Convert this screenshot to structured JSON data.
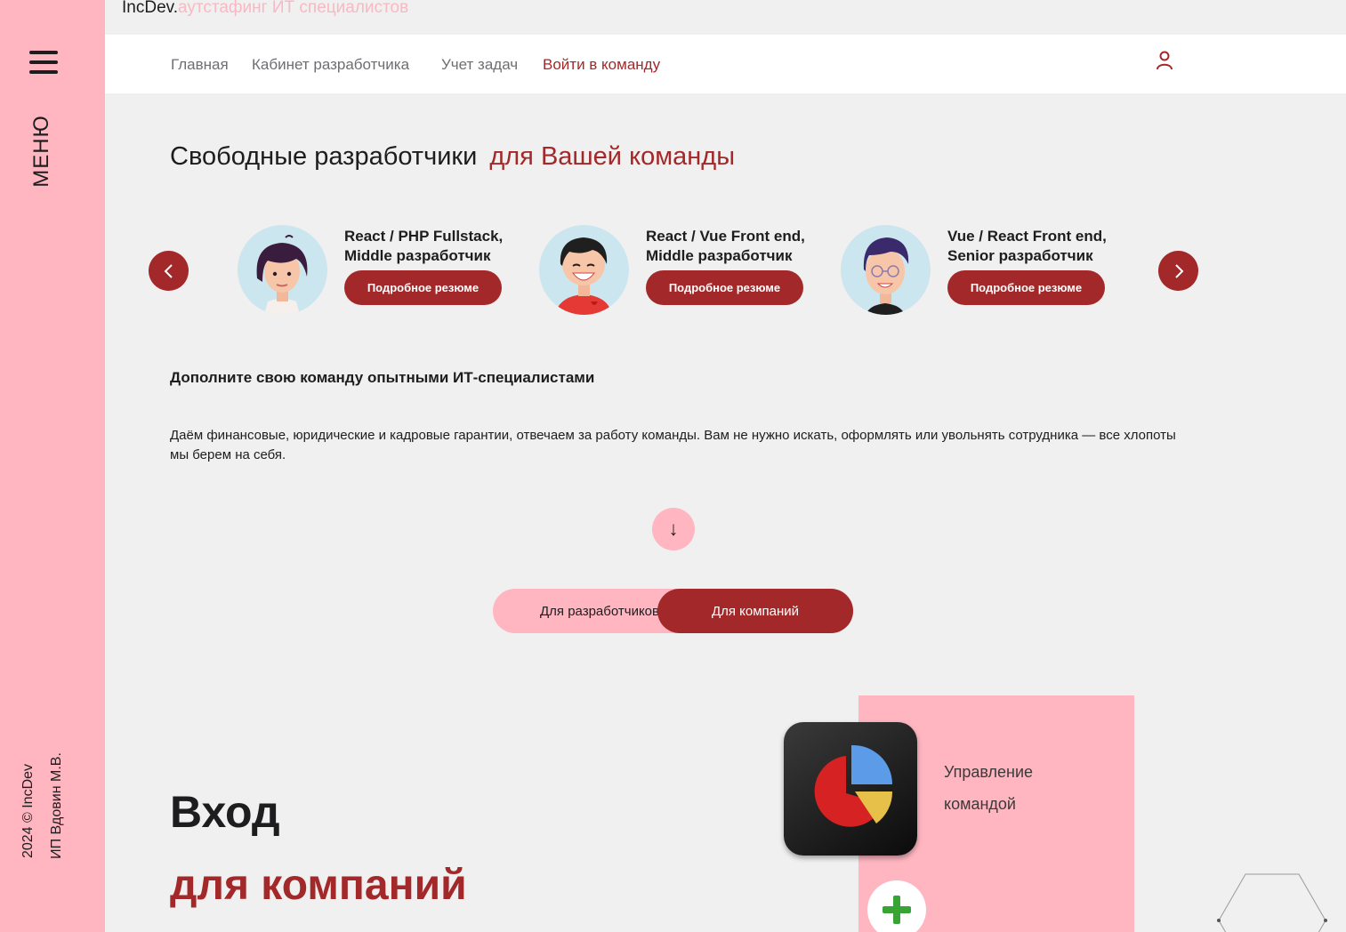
{
  "brand": {
    "name": "IncDev.",
    "tagline": "аутстафинг ИТ специалистов"
  },
  "sidebar": {
    "menu_label": "МЕНЮ",
    "copyright": "2024 © IncDev",
    "owner": "ИП Вдовин М.В."
  },
  "nav": {
    "items": [
      {
        "label": "Главная"
      },
      {
        "label": "Кабинет разработчика"
      },
      {
        "label": "Учет задач"
      },
      {
        "label": "Войти в команду"
      }
    ]
  },
  "hero": {
    "headline": "Свободные разработчики",
    "headline_accent": "для Вашей команды"
  },
  "carousel": {
    "cards": [
      {
        "title": "React / PHP Fullstack, Middle разработчик",
        "button": "Подробное резюме",
        "avatar": "female-developer-avatar"
      },
      {
        "title": "React / Vue Front end, Middle разработчик",
        "button": "Подробное резюме",
        "avatar": "smiling-boy-avatar"
      },
      {
        "title": "Vue / React Front end, Senior разработчик",
        "button": "Подробное резюме",
        "avatar": "glasses-man-avatar"
      }
    ]
  },
  "info": {
    "subheading": "Дополните свою команду опытными ИТ-специалистами",
    "description": "Даём финансовые, юридические и кадровые гарантии, отвечаем за работу команды. Вам не нужно искать, оформлять или увольнять сотрудника — все хлопоты мы берем на себя."
  },
  "scroll_down": "↓",
  "toggle": {
    "developers": "Для разработчиков",
    "companies": "Для компаний",
    "selected": "Для компаний"
  },
  "login": {
    "line1": "Вход",
    "line2": "для компаний"
  },
  "feature": {
    "text": "Управление командой"
  },
  "colors": {
    "accent": "#a3282a",
    "pink": "#ffb6c1",
    "background": "#f0f0f0"
  }
}
